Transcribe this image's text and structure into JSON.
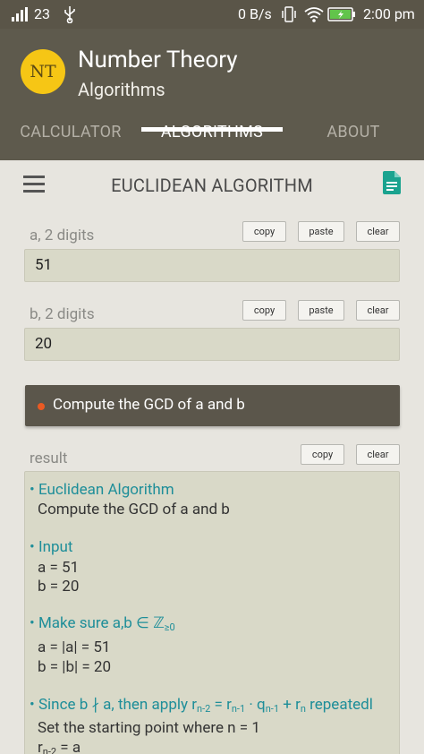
{
  "status_bar": {
    "signal_text": "23",
    "data_rate": "0 B/s",
    "time": "2:00 pm"
  },
  "app": {
    "logo_text": "NT",
    "title": "Number Theory",
    "subtitle": "Algorithms",
    "tabs": [
      "CALCULATOR",
      "ALGORITHMS",
      "ABOUT"
    ],
    "active_tab": "ALGORITHMS"
  },
  "toolbar": {
    "title": "EUCLIDEAN ALGORITHM"
  },
  "field_a": {
    "label": "a, 2 digits",
    "value": "51",
    "copy": "copy",
    "paste": "paste",
    "clear": "clear"
  },
  "field_b": {
    "label": "b, 2 digits",
    "value": "20",
    "copy": "copy",
    "paste": "paste",
    "clear": "clear"
  },
  "compute_button": "Compute the GCD of a and b",
  "result": {
    "label": "result",
    "copy": "copy",
    "clear": "clear",
    "lines": {
      "h1": "Euclidean Algorithm",
      "t1": "Compute the GCD of a and b",
      "h2": "Input",
      "t2": "a = 51",
      "t3": "b = 20",
      "h3_pre": "Make sure a,b ∈ ℤ",
      "h3_sub": "≥0",
      "t4": "a = |a| = 51",
      "t5": "b = |b| = 20",
      "h4_a": "Since b ∤ a, then apply r",
      "h4_s1": "n-2",
      "h4_b": " = r",
      "h4_s2": "n-1",
      "h4_c": " · q",
      "h4_s3": "n-1",
      "h4_d": " + r",
      "h4_s4": "n",
      "h4_e": " repeatedl",
      "t6": "Set the starting point where n = 1",
      "t7_a": "r",
      "t7_s": "n-2",
      "t7_b": " = a"
    }
  },
  "colors": {
    "status_bar": "#5a5548",
    "app_bar": "#5e5a4d",
    "logo": "#f6c615",
    "accent_heading": "#1e8e99",
    "compute_dot": "#ea5a23",
    "field_bg": "#d9d9c8",
    "doc_icon": "#1aa38f"
  }
}
